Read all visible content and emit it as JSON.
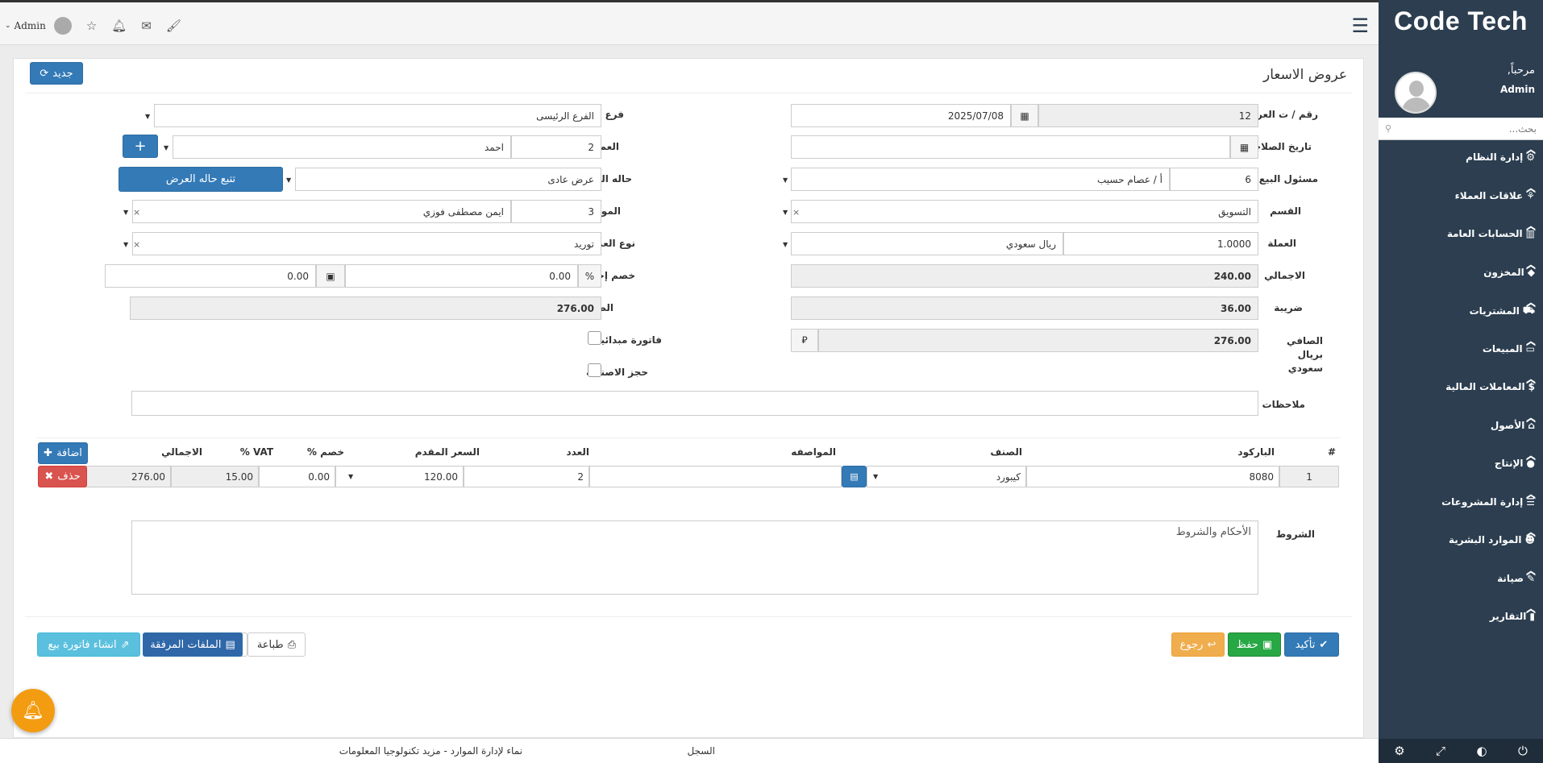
{
  "sidebar": {
    "brand": "Code Tech",
    "greeting": "مرحباً,",
    "username": "Admin",
    "search_placeholder": "بحث...",
    "items": [
      {
        "label": "إدارة النظام",
        "icon": "cogs-icon"
      },
      {
        "label": "علاقات العملاء",
        "icon": "sitemap-icon"
      },
      {
        "label": "الحسابات العامة",
        "icon": "columns-icon"
      },
      {
        "label": "المخزون",
        "icon": "cube-icon"
      },
      {
        "label": "المشتريات",
        "icon": "cart-icon"
      },
      {
        "label": "المبيعات",
        "icon": "credit-card-icon"
      },
      {
        "label": "المعاملات المالية",
        "icon": "dollar-icon"
      },
      {
        "label": "الأصول",
        "icon": "bank-icon"
      },
      {
        "label": "الإنتاج",
        "icon": "product-icon"
      },
      {
        "label": "إدارة المشروعات",
        "icon": "tasks-icon"
      },
      {
        "label": "الموارد البشرية",
        "icon": "users-icon"
      },
      {
        "label": "صيانة",
        "icon": "wrench-icon"
      },
      {
        "label": "التقارير",
        "icon": "chart-icon"
      }
    ]
  },
  "topbar": {
    "user": "Admin"
  },
  "page": {
    "title": "عروض الاسعار",
    "new_button": "جديد"
  },
  "form": {
    "offer_no": {
      "label": "رقم / ت العرض",
      "number": "12",
      "date": "2025/07/08"
    },
    "branch": {
      "label": "فرع",
      "value": "الفرع الرئيسى"
    },
    "validity": {
      "label": "تاريخ الصلاحية",
      "value": ""
    },
    "customer": {
      "label": "العميل",
      "code": "2",
      "name": "احمد"
    },
    "salesman": {
      "label": "مسئول البيع",
      "code": "6",
      "name": "أ / عصام حسيب"
    },
    "offer_status": {
      "label": "حاله العرض",
      "value": "عرض عادى",
      "track_button": "تتبع حاله العرض"
    },
    "department": {
      "label": "القسم",
      "value": "التسويق"
    },
    "supplier": {
      "label": "المورد",
      "code": "3",
      "name": "ايمن مصطفى فوزي"
    },
    "currency": {
      "label": "العملة",
      "rate": "1.0000",
      "name": "ريال سعودي"
    },
    "operation_type": {
      "label": "نوع العملية",
      "value": "توريد"
    },
    "total": {
      "label": "الاجمالي",
      "value": "240.00"
    },
    "discount": {
      "label": "خصم إجمالي",
      "percent_symbol": "%",
      "percent": "0.00",
      "amount": "0.00"
    },
    "tax": {
      "label": "ضريبة",
      "value": "36.00"
    },
    "net": {
      "label": "الصافي",
      "value": "276.00"
    },
    "net_sar": {
      "label": "الصافي بريال سعودي",
      "value": "276.00",
      "currency_symbol": "⃁"
    },
    "initial_invoice": {
      "label": "فاتورة مبدائية"
    },
    "reserve_items": {
      "label": "حجز الاصناف"
    },
    "notes": {
      "label": "ملاحظات",
      "value": ""
    }
  },
  "items_table": {
    "headers": {
      "num": "#",
      "barcode": "الباركود",
      "item": "الصنف",
      "spec": "المواصفه",
      "qty": "العدد",
      "price": "السعر المقدم",
      "discount": "خصم %",
      "vat": "VAT %",
      "total": "الاجمالي"
    },
    "add_button": "اضافة",
    "delete_button": "حذف",
    "rows": [
      {
        "num": "1",
        "barcode": "8080",
        "item": "كيبورد",
        "spec": "",
        "qty": "2",
        "price": "120.00",
        "discount": "0.00",
        "vat": "15.00",
        "total": "276.00"
      }
    ]
  },
  "terms": {
    "label": "الشروط",
    "value": "الأحكام والشروط"
  },
  "actions": {
    "confirm": "تأكيد",
    "save": "حفظ",
    "back": "رجوع",
    "print": "طباعة",
    "attachments": "الملفات المرفقة",
    "create_invoice": "انشاء فاتورة بيع"
  },
  "footer": {
    "log": "السجل",
    "copyright": "نماء لإدارة الموارد - مزيد تكنولوجيا المعلومات"
  }
}
